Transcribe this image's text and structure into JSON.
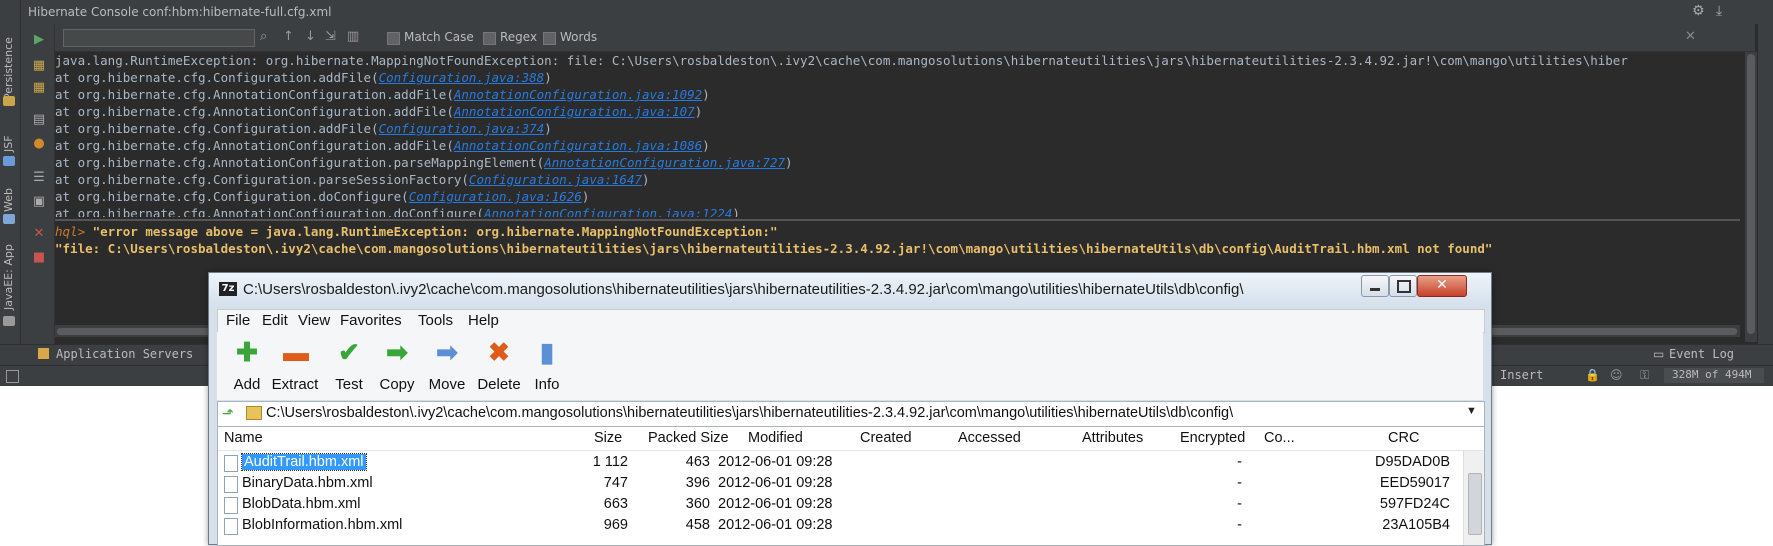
{
  "ide": {
    "title": "Hibernate Console conf:hbm:hibernate-full.cfg.xml",
    "left_tabs": [
      "Persistence",
      "JSF",
      "Web",
      "JavaEE: App"
    ],
    "find": {
      "input_value": "",
      "match_case": "Match Case",
      "regex": "Regex",
      "words": "Words"
    },
    "output_lines": [
      {
        "text": "java.lang.RuntimeException: org.hibernate.MappingNotFoundException: file: C:\\Users\\rosbaldeston\\.ivy2\\cache\\com.mangosolutions\\hibernateutilities\\jars\\hibernateutilities-2.3.4.92.jar!\\com\\mango\\utilities\\hiber",
        "link": ""
      },
      {
        "text": "    at org.hibernate.cfg.Configuration.addFile(",
        "link": "Configuration.java:388"
      },
      {
        "text": "    at org.hibernate.cfg.AnnotationConfiguration.addFile(",
        "link": "AnnotationConfiguration.java:1092"
      },
      {
        "text": "    at org.hibernate.cfg.AnnotationConfiguration.addFile(",
        "link": "AnnotationConfiguration.java:107"
      },
      {
        "text": "    at org.hibernate.cfg.Configuration.addFile(",
        "link": "Configuration.java:374"
      },
      {
        "text": "    at org.hibernate.cfg.AnnotationConfiguration.addFile(",
        "link": "AnnotationConfiguration.java:1086"
      },
      {
        "text": "    at org.hibernate.cfg.AnnotationConfiguration.parseMappingElement(",
        "link": "AnnotationConfiguration.java:727"
      },
      {
        "text": "    at org.hibernate.cfg.Configuration.parseSessionFactory(",
        "link": "Configuration.java:1647"
      },
      {
        "text": "    at org.hibernate.cfg.Configuration.doConfigure(",
        "link": "Configuration.java:1626"
      },
      {
        "text": "    at org.hibernate.cfg.AnnotationConfiguration.doConfigure(",
        "link": "AnnotationConfiguration.java:1224"
      }
    ],
    "hql": {
      "prompt": "hql>",
      "line1": " \"error message above = java.lang.RuntimeException: org.hibernate.MappingNotFoundException:\"",
      "line2": "\"file: C:\\Users\\rosbaldeston\\.ivy2\\cache\\com.mangosolutions\\hibernateutilities\\jars\\hibernateutilities-2.3.4.92.jar!\\com\\mango\\utilities\\hibernateUtils\\db\\config\\AuditTrail.hbm.xml not found\""
    },
    "bottom_tab": "Application Servers",
    "event_log": "Event Log",
    "status": {
      "insert": "Insert",
      "memory": "328M of 494M"
    }
  },
  "zip": {
    "title": "C:\\Users\\rosbaldeston\\.ivy2\\cache\\com.mangosolutions\\hibernateutilities\\jars\\hibernateutilities-2.3.4.92.jar\\com\\mango\\utilities\\hibernateUtils\\db\\config\\",
    "logo": "7z",
    "menu": [
      "File",
      "Edit",
      "View",
      "Favorites",
      "Tools",
      "Help"
    ],
    "toolbar": [
      "Add",
      "Extract",
      "Test",
      "Copy",
      "Move",
      "Delete",
      "Info"
    ],
    "address": "C:\\Users\\rosbaldeston\\.ivy2\\cache\\com.mangosolutions\\hibernateutilities\\jars\\hibernateutilities-2.3.4.92.jar\\com\\mango\\utilities\\hibernateUtils\\db\\config\\",
    "columns": [
      "Name",
      "Size",
      "Packed Size",
      "Modified",
      "Created",
      "Accessed",
      "Attributes",
      "Encrypted",
      "Co...",
      "CRC"
    ],
    "rows": [
      {
        "name": "AuditTrail.hbm.xml",
        "size": "1 112",
        "packed": "463",
        "modified": "2012-06-01 09:28",
        "encrypted": "-",
        "crc": "D95DAD0B",
        "selected": true
      },
      {
        "name": "BinaryData.hbm.xml",
        "size": "747",
        "packed": "396",
        "modified": "2012-06-01 09:28",
        "encrypted": "-",
        "crc": "EED59017",
        "selected": false
      },
      {
        "name": "BlobData.hbm.xml",
        "size": "663",
        "packed": "360",
        "modified": "2012-06-01 09:28",
        "encrypted": "-",
        "crc": "597FD24C",
        "selected": false
      },
      {
        "name": "BlobInformation.hbm.xml",
        "size": "969",
        "packed": "458",
        "modified": "2012-06-01 09:28",
        "encrypted": "-",
        "crc": "23A105B4",
        "selected": false
      }
    ]
  }
}
